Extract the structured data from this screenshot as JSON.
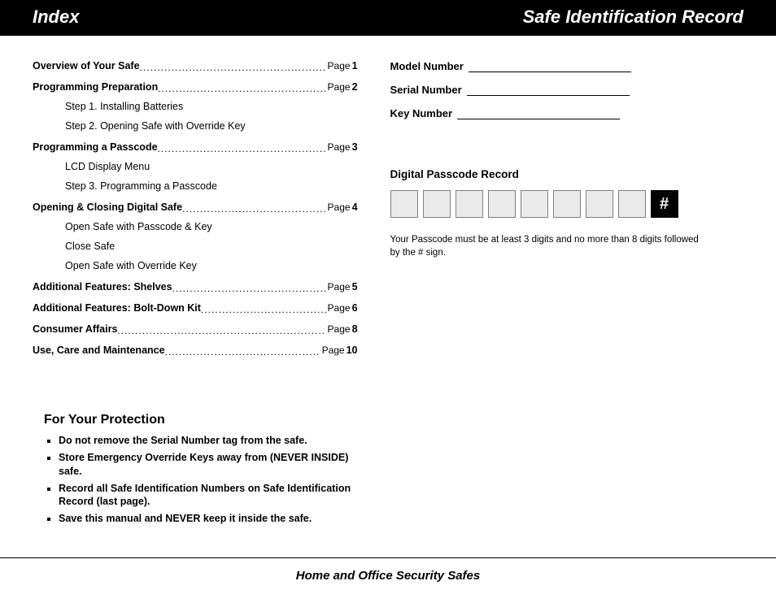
{
  "header": {
    "left": "Index",
    "right": "Safe Identification Record"
  },
  "index": {
    "entries": [
      {
        "title": "Overview of Your Safe",
        "page_word": "Page",
        "page_num": "1",
        "subs": []
      },
      {
        "title": "Programming Preparation",
        "page_word": "Page",
        "page_num": "2",
        "subs": [
          "Step 1. Installing Batteries",
          "Step 2. Opening Safe with Override Key"
        ]
      },
      {
        "title": "Programming a Passcode",
        "page_word": "Page",
        "page_num": "3",
        "subs": [
          "LCD Display Menu",
          "Step 3. Programming a Passcode"
        ]
      },
      {
        "title": "Opening & Closing Digital Safe",
        "page_word": "Page",
        "page_num": "4",
        "subs": [
          "Open Safe with Passcode & Key",
          "Close Safe",
          "Open Safe with Override Key"
        ]
      },
      {
        "title": "Additional Features: Shelves",
        "page_word": "Page",
        "page_num": "5",
        "subs": []
      },
      {
        "title": "Additional Features: Bolt-Down Kit",
        "page_word": "Page",
        "page_num": "6",
        "subs": []
      },
      {
        "title": "Consumer Affairs",
        "page_word": "Page",
        "page_num": "8",
        "subs": []
      },
      {
        "title": "Use, Care and Maintenance",
        "page_word": "Page",
        "page_num": "10",
        "subs": []
      }
    ]
  },
  "protection": {
    "title": "For Your Protection",
    "items": [
      "Do not remove the Serial Number tag from the safe.",
      "Store Emergency Override Keys away from (NEVER INSIDE) safe.",
      "Record all Safe Identification Numbers on Safe Identification Record (last page).",
      "Save this manual and NEVER keep it inside the safe."
    ]
  },
  "record": {
    "fields": [
      "Model Number",
      "Serial Number",
      "Key Number"
    ],
    "passcode_heading": "Digital Passcode Record",
    "passcode_box_count": 8,
    "hash_symbol": "#",
    "note": "Your Passcode must be at least 3 digits and no more than 8 digits followed by the # sign."
  },
  "footer": "Home and Office Security Safes"
}
